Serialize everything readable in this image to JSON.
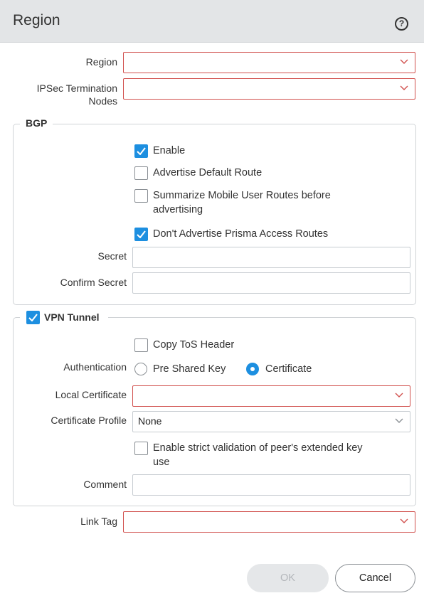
{
  "dialog": {
    "title": "Region",
    "help_icon": "?"
  },
  "form": {
    "region_label": "Region",
    "ipsec_label_line1": "IPSec Termination",
    "ipsec_label_line2": "Nodes"
  },
  "bgp": {
    "legend": "BGP",
    "enable": {
      "label": "Enable",
      "checked": true
    },
    "advertise_default": {
      "label": "Advertise Default Route",
      "checked": false
    },
    "summarize": {
      "label_line1": "Summarize Mobile User Routes before",
      "label_line2": "advertising",
      "checked": false
    },
    "dont_advertise": {
      "label": "Don't Advertise Prisma Access Routes",
      "checked": true
    },
    "secret_label": "Secret",
    "confirm_secret_label": "Confirm Secret"
  },
  "vpn": {
    "legend": "VPN Tunnel",
    "checked": true,
    "copy_tos": {
      "label": "Copy ToS Header",
      "checked": false
    },
    "authentication_label": "Authentication",
    "auth_options": [
      "Pre Shared Key",
      "Certificate"
    ],
    "auth_selected": "Certificate",
    "local_cert_label": "Local Certificate",
    "cert_profile_label": "Certificate Profile",
    "cert_profile_value": "None",
    "strict_validation": {
      "label_line1": "Enable strict validation of peer's extended key",
      "label_line2": "use",
      "checked": false
    },
    "comment_label": "Comment"
  },
  "link_tag_label": "Link Tag",
  "buttons": {
    "ok": "OK",
    "cancel": "Cancel"
  },
  "colors": {
    "accent": "#1d8fe0",
    "error_border": "#d1504d",
    "header_bg": "#e3e5e7"
  }
}
